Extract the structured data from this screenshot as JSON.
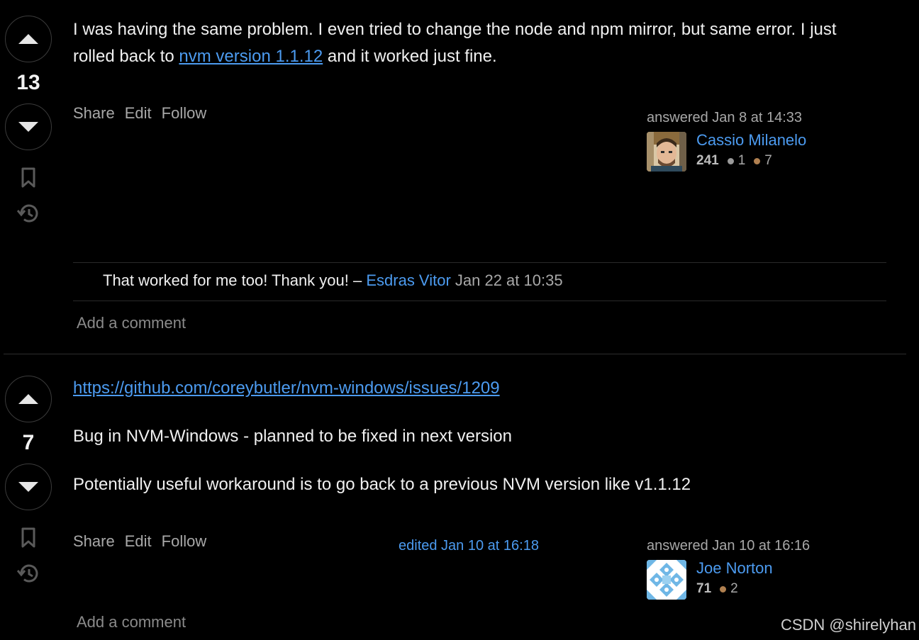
{
  "answers": [
    {
      "votes": "13",
      "body_text_1": "I was having the same problem. I even tried to change the node and npm mirror, but same error. I just rolled back to ",
      "link_text": "nvm version 1.1.12",
      "body_text_2": " and it worked just fine.",
      "menu": {
        "share": "Share",
        "edit": "Edit",
        "follow": "Follow"
      },
      "answered": "answered Jan 8 at 14:33",
      "user": {
        "name": "Cassio Milanelo",
        "rep": "241",
        "silver": "1",
        "bronze": "7"
      },
      "comment": {
        "text": "That worked for me too! Thank you! – ",
        "user": "Esdras Vitor",
        "date": "Jan 22 at 10:35"
      },
      "add_comment": "Add a comment"
    },
    {
      "votes": "7",
      "link_text": "https://github.com/coreybutler/nvm-windows/issues/1209",
      "para_1": "Bug in NVM-Windows - planned to be fixed in next version",
      "para_2": "Potentially useful workaround is to go back to a previous NVM version like v1.1.12",
      "menu": {
        "share": "Share",
        "edit": "Edit",
        "follow": "Follow"
      },
      "edited": "edited Jan 10 at 16:18",
      "answered": "answered Jan 10 at 16:16",
      "user": {
        "name": "Joe Norton",
        "rep": "71",
        "bronze": "2"
      },
      "add_comment": "Add a comment"
    }
  ],
  "watermark": "CSDN @shirelyhan",
  "colors": {
    "link": "#4c9bf0",
    "muted": "#a8a8a8",
    "background": "#000000"
  },
  "icons": [
    "upvote-icon",
    "downvote-icon",
    "bookmark-icon",
    "history-icon"
  ]
}
